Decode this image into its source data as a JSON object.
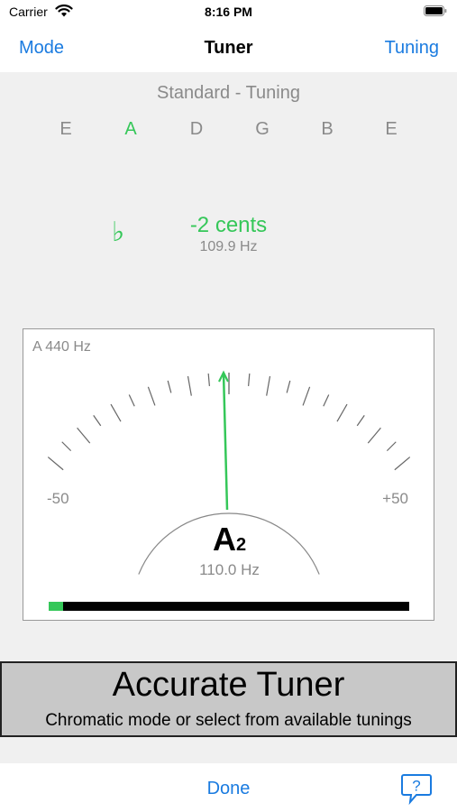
{
  "status_bar": {
    "carrier": "Carrier",
    "time": "8:16 PM"
  },
  "nav": {
    "left_label": "Mode",
    "title": "Tuner",
    "right_label": "Tuning"
  },
  "tuning": {
    "name": "Standard - Tuning",
    "strings": [
      "E",
      "A",
      "D",
      "G",
      "B",
      "E"
    ],
    "active_string_index": 1
  },
  "reading": {
    "flat_symbol": "♭",
    "cents": "-2 cents",
    "frequency": "109.9 Hz"
  },
  "meter": {
    "reference": "A 440 Hz",
    "min_label": "-50",
    "max_label": "+50",
    "needle_cents": -2,
    "note": "A",
    "octave": "2",
    "note_frequency": "110.0 Hz",
    "level_fraction": 0.04
  },
  "banner": {
    "title": "Accurate Tuner",
    "subtitle": "Chromatic mode or select from available tunings"
  },
  "bottom": {
    "done_label": "Done",
    "help_icon": "question-bubble-icon"
  },
  "colors": {
    "accent": "#1a7be0",
    "in_tune": "#35c759",
    "muted": "#8a8a8a"
  }
}
